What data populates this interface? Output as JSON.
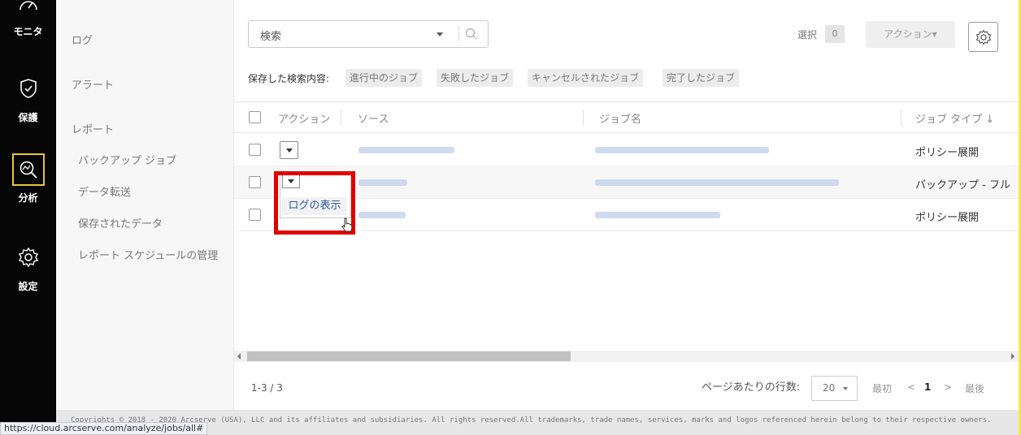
{
  "nav": {
    "items": [
      {
        "label": "モニタ",
        "icon": "speedometer-icon"
      },
      {
        "label": "保護",
        "icon": "shield-check-icon"
      },
      {
        "label": "分析",
        "icon": "analyze-icon"
      },
      {
        "label": "設定",
        "icon": "gear-icon"
      }
    ]
  },
  "submenu": {
    "log": "ログ",
    "alert": "アラート",
    "report": "レポート",
    "backup_job": "バックアップ ジョブ",
    "data_transfer": "データ転送",
    "saved_data": "保存されたデータ",
    "report_schedule": "レポート スケジュールの管理"
  },
  "toolbar": {
    "search_placeholder": "検索",
    "select_label": "選択",
    "select_count": "0",
    "action_label": "アクション▾",
    "saved_search_label": "保存した検索内容:",
    "chips": [
      "進行中のジョブ",
      "失敗したジョブ",
      "キャンセルされたジョブ",
      "完了したジョブ"
    ]
  },
  "table": {
    "headers": {
      "action": "アクション",
      "source": "ソース",
      "job_name": "ジョブ名",
      "job_type": "ジョブ タイプ ↓"
    },
    "rows": [
      {
        "job_type": "ポリシー展開"
      },
      {
        "job_type": "バックアップ - フル"
      },
      {
        "job_type": "ポリシー展開"
      }
    ],
    "popup_item": "ログの表示"
  },
  "pagination": {
    "count": "1-3 / 3",
    "rows_per_page_label": "ページあたりの行数:",
    "rows_per_page": "20",
    "first": "最初",
    "prev": "<",
    "current": "1",
    "next": ">",
    "last": "最後"
  },
  "footer": {
    "copyright": "Copyrights © 2018 - 2020 Arcserve (USA), LLC and its affiliates and subsidiaries. All rights reserved.All trademarks, trade names, services, marks and logos referenced herein belong to their respective owners."
  },
  "status_url": "https://cloud.arcserve.com/analyze/jobs/all#",
  "colors": {
    "highlight": "#e00000",
    "nav_bg": "#060606",
    "active_border": "#e6c53a",
    "link": "#2a56a6"
  }
}
